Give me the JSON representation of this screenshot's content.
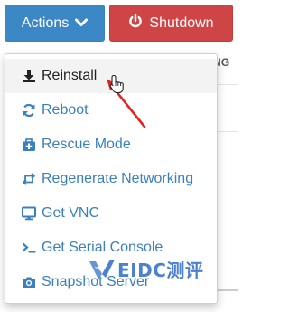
{
  "toolbar": {
    "actions_label": "Actions",
    "shutdown_label": "Shutdown"
  },
  "background": {
    "header_fragment": "NG"
  },
  "menu": {
    "items": [
      {
        "label": "Reinstall",
        "icon": "download-icon"
      },
      {
        "label": "Reboot",
        "icon": "refresh-icon"
      },
      {
        "label": "Rescue Mode",
        "icon": "medkit-icon"
      },
      {
        "label": "Regenerate Networking",
        "icon": "retweet-icon"
      },
      {
        "label": "Get VNC",
        "icon": "desktop-icon"
      },
      {
        "label": "Get Serial Console",
        "icon": "terminal-icon"
      },
      {
        "label": "Snapshot Server",
        "icon": "camera-icon"
      }
    ]
  },
  "watermark": {
    "text": "EIDC测评"
  },
  "colors": {
    "primary": "#3c88c6",
    "danger": "#cf4545",
    "link": "#3a80bb",
    "annotation_arrow": "#e02424"
  }
}
